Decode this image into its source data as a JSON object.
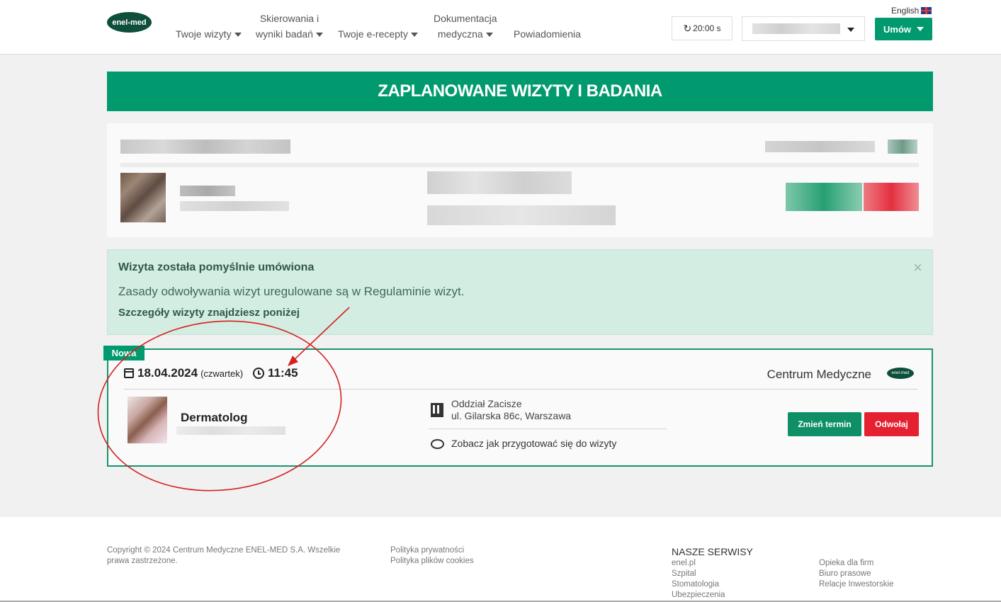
{
  "header": {
    "logo_text": "enel-med",
    "nav": {
      "wizyty": "Twoje wizyty",
      "skierowania_line1": "Skierowania i",
      "skierowania_line2": "wyniki badań",
      "erecepty": "Twoje e-recepty",
      "dokumentacja_line1": "Dokumentacja",
      "dokumentacja_line2": "medyczna",
      "powiadomienia": "Powiadomienia"
    },
    "timer": "20:00 s",
    "language": "English",
    "umow": "Umów"
  },
  "banner": {
    "title": "ZAPLANOWANE WIZYTY I BADANIA"
  },
  "alert": {
    "title": "Wizyta została pomyślnie umówiona",
    "text": "Zasady odwoływania wizyt uregulowane są w Regulaminie wizyt.",
    "details": "Szczegóły wizyty znajdziesz poniżej",
    "close": "×"
  },
  "visit": {
    "badge": "Nowa",
    "date": "18.04.2024",
    "weekday": "(czwartek)",
    "time": "11:45",
    "center": "Centrum Medyczne",
    "center_logo": "enel-med",
    "specialty": "Dermatolog",
    "location_name": "Oddział Zacisze",
    "location_address": "ul. Gilarska 86c, Warszawa",
    "prepare_link": "Zobacz jak przygotować się do wizyty",
    "change_button": "Zmień termin",
    "cancel_button": "Odwołaj"
  },
  "footer": {
    "copyright_line1": "Copyright © 2024 Centrum Medyczne ENEL-MED S.A. Wszelkie",
    "copyright_line2": "prawa zastrzeżone.",
    "policy_privacy": "Polityka prywatności",
    "policy_cookies": "Polityka plików cookies",
    "services_title": "NASZE SERWISY",
    "services_col1": [
      "enel.pl",
      "Szpital",
      "Stomatologia",
      "Ubezpieczenia"
    ],
    "services_col2": [
      "Opieka dla firm",
      "Biuro prasowe",
      "Relacje Inwestorskie"
    ]
  },
  "colors": {
    "brand_green": "#009a6e",
    "danger_red": "#e52030",
    "annotation_red": "#d42020"
  }
}
